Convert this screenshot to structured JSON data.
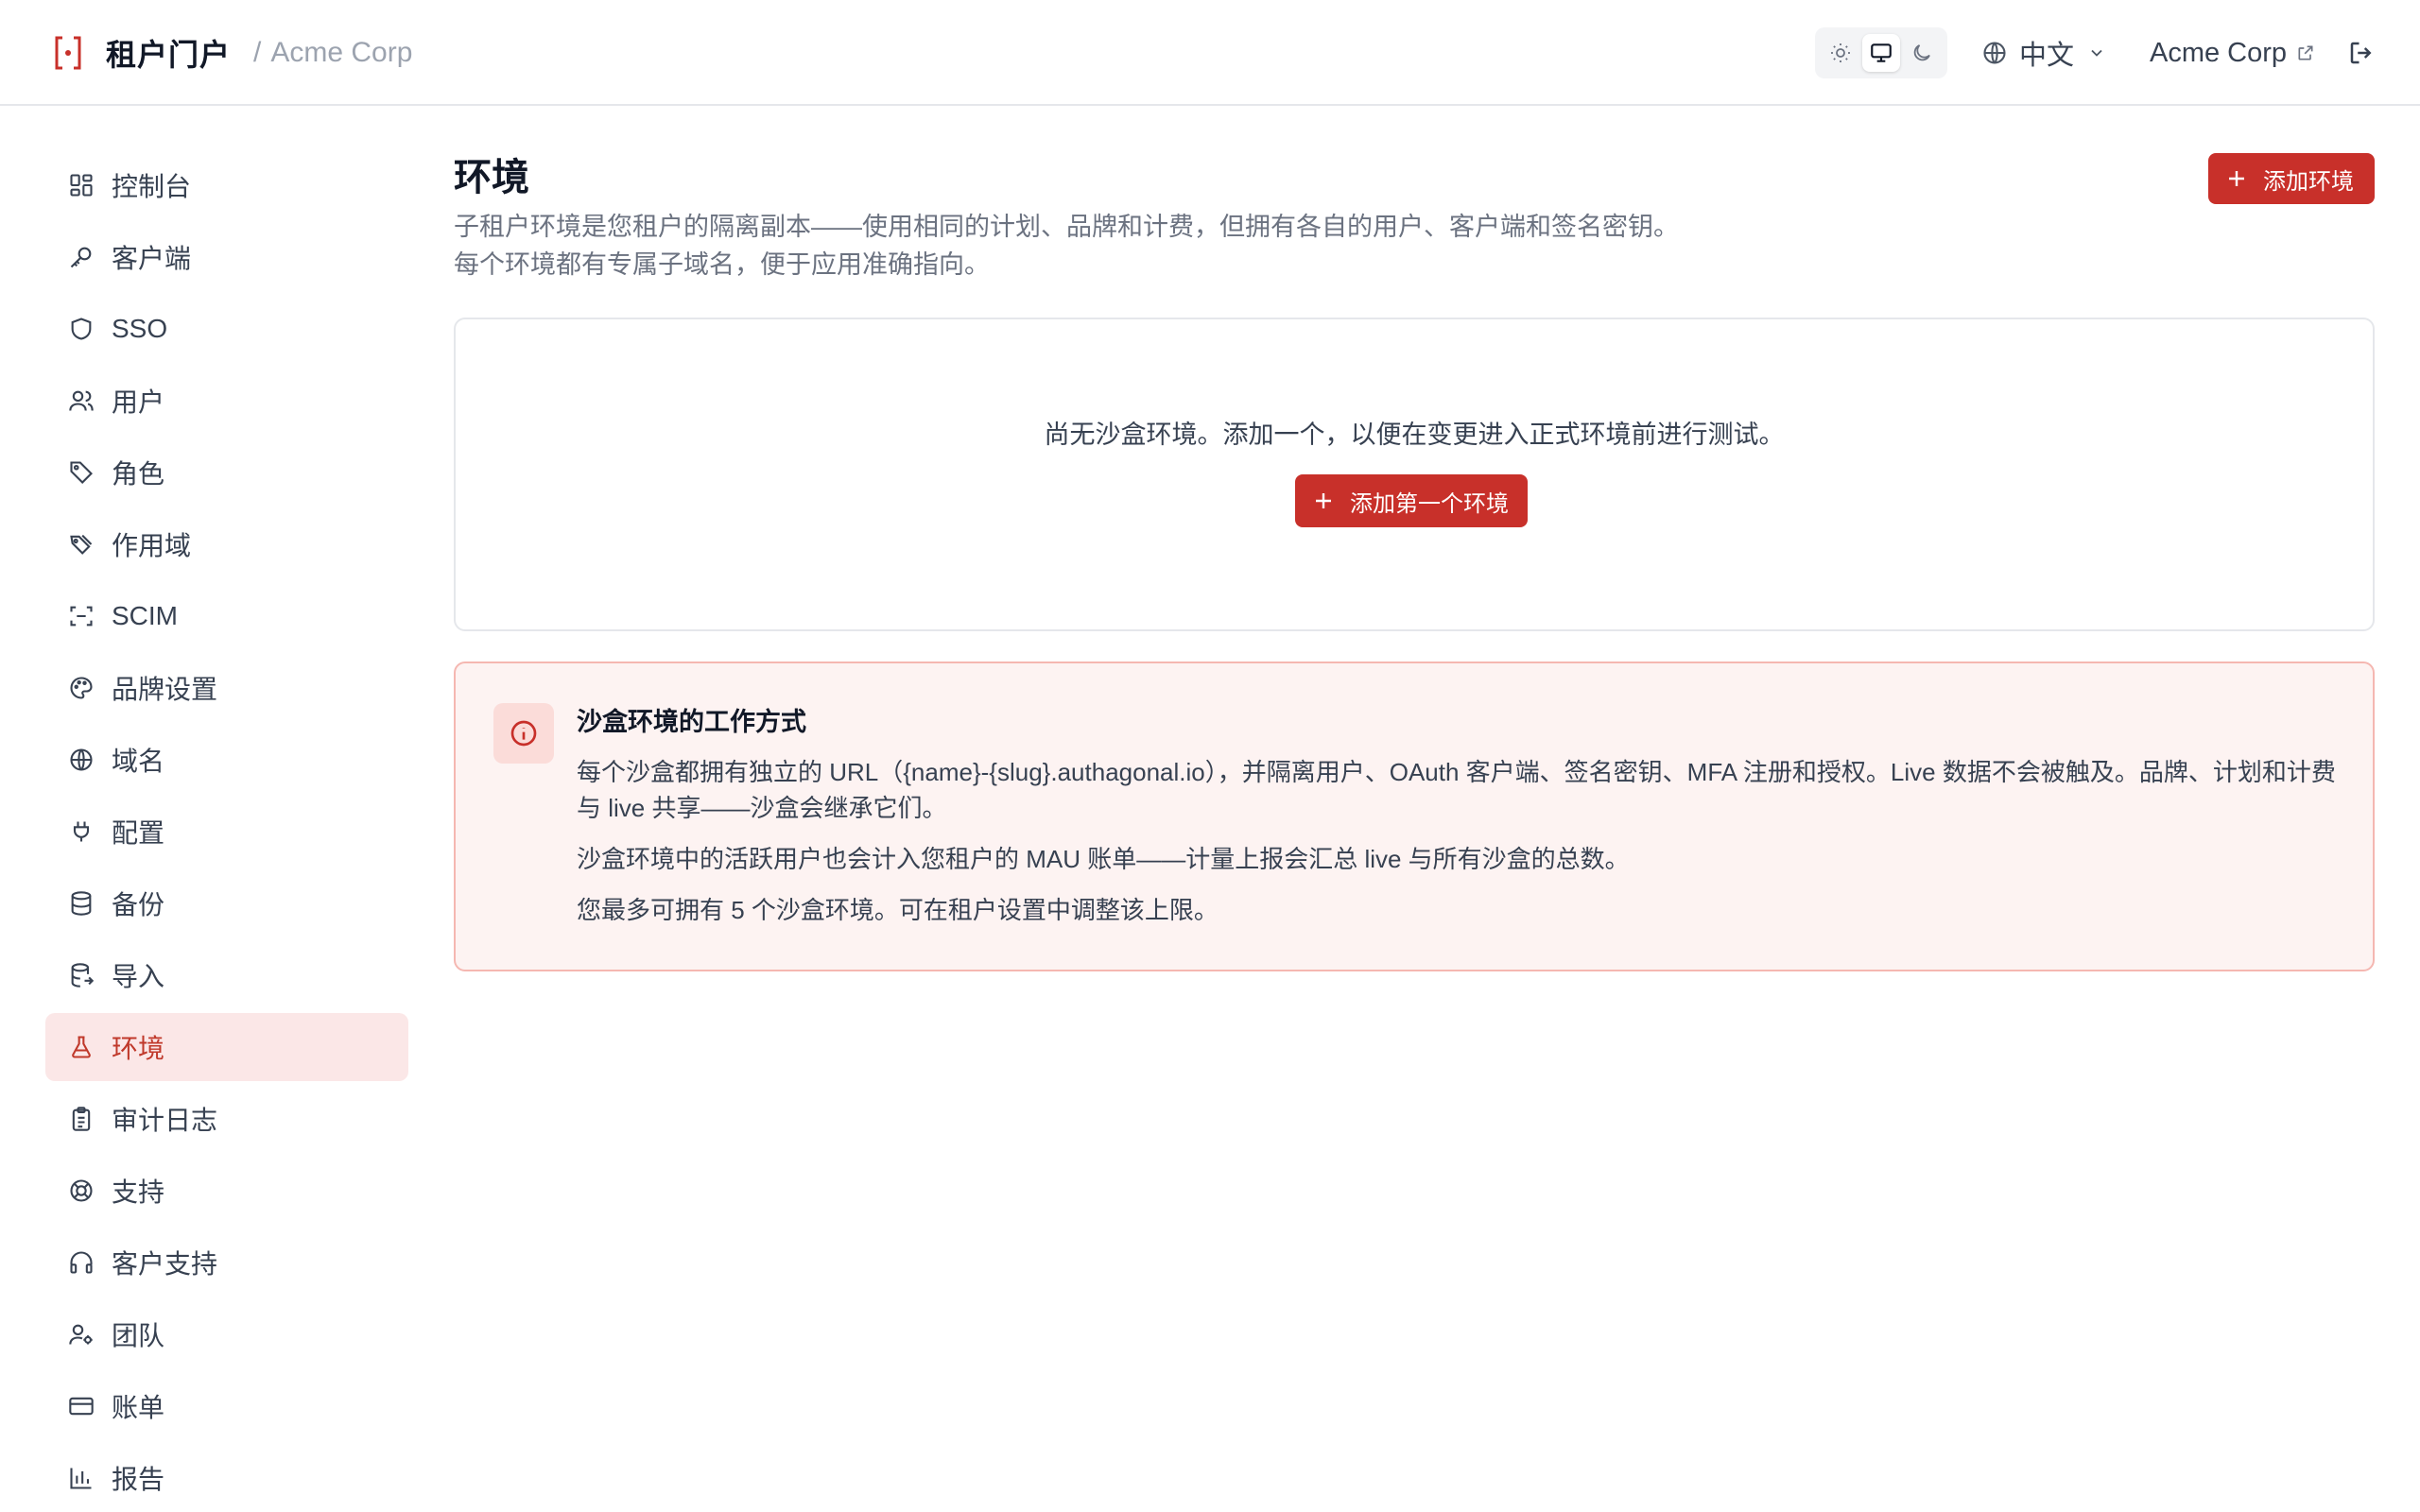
{
  "header": {
    "app_title": "租户门户",
    "separator": "/",
    "tenant_name": "Acme Corp",
    "language": "中文",
    "account_name": "Acme Corp",
    "theme_options": [
      "light",
      "system",
      "dark"
    ],
    "theme_selected": "system"
  },
  "sidebar": {
    "items": [
      {
        "label": "控制台",
        "icon": "dashboard-icon"
      },
      {
        "label": "客户端",
        "icon": "key-icon"
      },
      {
        "label": "SSO",
        "icon": "shield-icon"
      },
      {
        "label": "用户",
        "icon": "users-icon"
      },
      {
        "label": "角色",
        "icon": "tag-icon"
      },
      {
        "label": "作用域",
        "icon": "tags-icon"
      },
      {
        "label": "SCIM",
        "icon": "scan-icon"
      },
      {
        "label": "品牌设置",
        "icon": "palette-icon"
      },
      {
        "label": "域名",
        "icon": "globe-icon"
      },
      {
        "label": "配置",
        "icon": "plug-icon"
      },
      {
        "label": "备份",
        "icon": "database-icon"
      },
      {
        "label": "导入",
        "icon": "database-import-icon"
      },
      {
        "label": "环境",
        "icon": "flask-icon",
        "active": true
      },
      {
        "label": "审计日志",
        "icon": "clipboard-icon"
      },
      {
        "label": "支持",
        "icon": "lifebuoy-icon"
      },
      {
        "label": "客户支持",
        "icon": "headphones-icon"
      },
      {
        "label": "团队",
        "icon": "user-cog-icon"
      },
      {
        "label": "账单",
        "icon": "credit-card-icon"
      },
      {
        "label": "报告",
        "icon": "bar-chart-icon"
      }
    ]
  },
  "main": {
    "title": "环境",
    "description_line1": "子租户环境是您租户的隔离副本——使用相同的计划、品牌和计费，但拥有各自的用户、客户端和签名密钥。",
    "description_line2": "每个环境都有专属子域名，便于应用准确指向。",
    "add_button": "添加环境",
    "empty_state": {
      "text": "尚无沙盒环境。添加一个，以便在变更进入正式环境前进行测试。",
      "button": "添加第一个环境"
    },
    "info": {
      "title": "沙盒环境的工作方式",
      "p1": "每个沙盒都拥有独立的 URL（{name}-{slug}.authagonal.io），并隔离用户、OAuth 客户端、签名密钥、MFA 注册和授权。Live 数据不会被触及。品牌、计划和计费与 live 共享——沙盒会继承它们。",
      "p2": "沙盒环境中的活跃用户也会计入您租户的 MAU 账单——计量上报会汇总 live 与所有沙盒的总数。",
      "p3": "您最多可拥有 5 个沙盒环境。可在租户设置中调整该上限。"
    }
  },
  "colors": {
    "accent": "#c8302a",
    "active_bg": "#fbe7e7",
    "info_bg": "#fdf3f2",
    "info_border": "#f5b7b1"
  }
}
